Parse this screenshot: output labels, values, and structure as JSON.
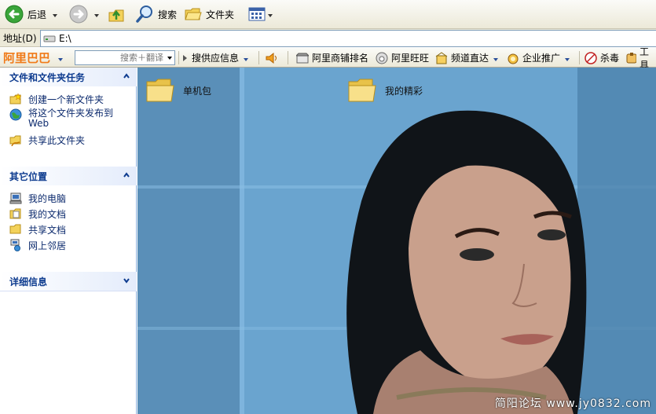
{
  "toolbar": {
    "back_label": "后退",
    "search_label": "搜索",
    "folders_label": "文件夹"
  },
  "address": {
    "label": "地址(D)",
    "path": "E:\\"
  },
  "alibaba_bar": {
    "logo": "阿里巴巴",
    "search_placeholder": "搜索＋翻译",
    "supply_label": "搜供应信息",
    "rank_label": "阿里商铺排名",
    "wangwang_label": "阿里旺旺",
    "channel_label": "频道直达",
    "promo_label": "企业推广",
    "antivirus_label": "杀毒",
    "tools_label": "工具"
  },
  "left_panel": {
    "file_tasks": {
      "title": "文件和文件夹任务",
      "items": [
        {
          "label": "创建一个新文件夹",
          "icon": "new-folder-icon"
        },
        {
          "label": "将这个文件夹发布到 Web",
          "icon": "publish-web-icon"
        },
        {
          "label": "共享此文件夹",
          "icon": "share-folder-icon"
        }
      ]
    },
    "other_places": {
      "title": "其它位置",
      "items": [
        {
          "label": "我的电脑",
          "icon": "my-computer-icon"
        },
        {
          "label": "我的文档",
          "icon": "my-documents-icon"
        },
        {
          "label": "共享文档",
          "icon": "shared-documents-icon"
        },
        {
          "label": "网上邻居",
          "icon": "network-places-icon"
        }
      ]
    },
    "details": {
      "title": "详细信息"
    }
  },
  "content": {
    "folders": [
      {
        "name": "单机包"
      },
      {
        "name": "我的精彩"
      }
    ],
    "watermark": "简阳论坛 www.jy0832.com"
  },
  "colors": {
    "panel_heading": "#0d3b8f",
    "alibaba_orange": "#f07a18",
    "background_blue": "#6aa4cf"
  }
}
